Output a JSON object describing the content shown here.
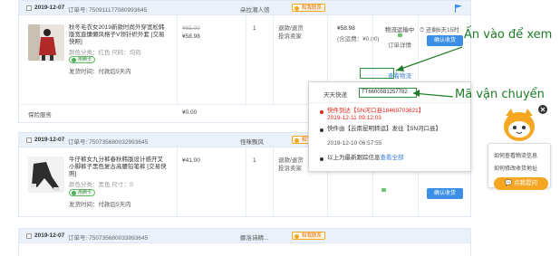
{
  "orders": [
    {
      "date": "2019-12-07",
      "order_no": "订单号: 750911177080993645",
      "shop": "朵拉潮人馆",
      "contact": "和我联系",
      "item": {
        "title": "秋冬毛衣女2019新款时尚外穿宽松韩版宽直慵懒风格子V领针织外套 [交易快照]",
        "spec": "颜色分类：红色  尺码：均码",
        "badge": "用腾卡",
        "note": "发货时间：付款后5天内",
        "old_price": "¥65.00",
        "price": "¥58.98",
        "qty": "1",
        "service": [
          "退款/退货",
          "投诉卖家"
        ],
        "total": "¥58.98",
        "shipping": "(含运费：¥0.00)",
        "status": "物流运输中",
        "detail_link": "订单详情",
        "track_link": "查看物流",
        "remain": "还剩6天15时",
        "button": "确认收货"
      },
      "footer_label": "保险服务",
      "footer_value": "¥0.00"
    },
    {
      "date": "2019-12-07",
      "order_no": "订单号: 750735680032993645",
      "shop": "怪咪飘风",
      "contact": "和我联系",
      "item": {
        "title": "牛仔裤女九分裤春秋韩版设计感开叉小脚裤子黑色复古高腰铅笔裤 [交易快照]",
        "spec": "颜色分类：黑色  尺寸：S",
        "badge": "用腾卡",
        "note": "发货时间：付款后5天内",
        "price": "¥41.00",
        "qty": "1",
        "service": [
          "退款/退货",
          "投诉卖家"
        ],
        "button": "确认收货"
      }
    },
    {
      "date": "2019-12-07",
      "order_no": "订单号: 750735680033993645",
      "shop": "娜洛诗精...",
      "contact": "和我联系"
    }
  ],
  "popup": {
    "carrier": "天天快递",
    "tracking_number": "TT6600581257782",
    "events": [
      {
        "text": "快件到达【SN河口县18469703621】",
        "time": "2019-12-11 09:12:03",
        "highlight": true
      },
      {
        "text": "快件由【云南昆明转运】发往【SN河口县】",
        "time": "2019-12-10 06:57:55",
        "highlight": false
      },
      {
        "text": "以上为最新跟踪信息",
        "link": "查看全部",
        "highlight": false
      }
    ]
  },
  "annotations": {
    "click_note": "Ấn vào để xem",
    "tracking_note": "Mã vận chuyển"
  },
  "assistant": {
    "questions": [
      "如何查看物流信息",
      "如何修改收货地址"
    ],
    "ask_button": "点我提问"
  },
  "colors": {
    "annotation_green": "#1e7b28",
    "accent_blue": "#3a8ee6",
    "header_bg": "#eaf1fb",
    "assistant_orange": "#f5a623"
  }
}
